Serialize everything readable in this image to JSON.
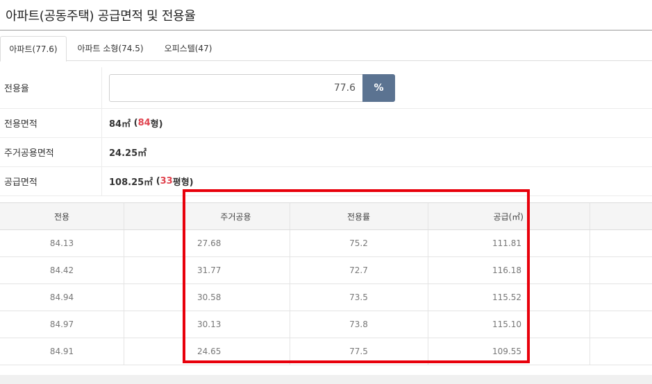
{
  "header": {
    "title": "아파트(공동주택) 공급면적 및 전용율"
  },
  "tabs": [
    {
      "label": "아파트(77.6)",
      "active": true
    },
    {
      "label": "아파트 소형(74.5)",
      "active": false
    },
    {
      "label": "오피스텔(47)",
      "active": false
    }
  ],
  "info": {
    "ratio_label": "전용율",
    "ratio_value": "77.6",
    "ratio_unit_button": "%",
    "exclusive_label": "전용면적",
    "exclusive_value": "84㎡",
    "exclusive_paren_open": " (",
    "exclusive_pyeong": "84",
    "exclusive_pyeong_suffix": "형)",
    "common_label": "주거공용면적",
    "common_value": "24.25㎡",
    "supply_label": "공급면적",
    "supply_value": "108.25㎡",
    "supply_paren_open": " (",
    "supply_pyeong": "33",
    "supply_pyeong_suffix": "평형)"
  },
  "table": {
    "headers": [
      "전용",
      "주거공용",
      "전용률",
      "공급(㎡)"
    ],
    "rows": [
      [
        "84.13",
        "27.68",
        "75.2",
        "111.81"
      ],
      [
        "84.42",
        "31.77",
        "72.7",
        "116.18"
      ],
      [
        "84.94",
        "30.58",
        "73.5",
        "115.52"
      ],
      [
        "84.97",
        "30.13",
        "73.8",
        "115.10"
      ],
      [
        "84.91",
        "24.65",
        "77.5",
        "109.55"
      ]
    ]
  },
  "colors": {
    "accent_button": "#5b7391",
    "highlight_red": "#e8000b",
    "value_red": "#e0434e"
  }
}
